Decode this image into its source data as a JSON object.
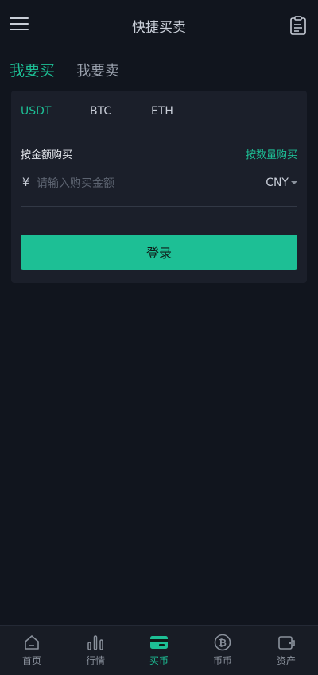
{
  "header": {
    "title": "快捷买卖",
    "menu_icon": "hamburger-icon",
    "orders_icon": "order-list-icon"
  },
  "trade_tabs": [
    {
      "label": "我要买",
      "active": true
    },
    {
      "label": "我要卖",
      "active": false
    }
  ],
  "coin_tabs": [
    {
      "label": "USDT",
      "active": true
    },
    {
      "label": "BTC",
      "active": false
    },
    {
      "label": "ETH",
      "active": false
    }
  ],
  "form": {
    "mode_label": "按金额购买",
    "mode_switch": "按数量购买",
    "currency_symbol": "¥",
    "amount_placeholder": "请输入购买金额",
    "amount_value": "",
    "fiat_currency": "CNY",
    "submit_label": "登录"
  },
  "bottom_nav": [
    {
      "label": "首页",
      "icon": "home-icon",
      "active": false
    },
    {
      "label": "行情",
      "icon": "bar-chart-icon",
      "active": false
    },
    {
      "label": "买币",
      "icon": "wallet-card-icon",
      "active": true
    },
    {
      "label": "币币",
      "icon": "bitcoin-icon",
      "active": false
    },
    {
      "label": "资产",
      "icon": "asset-wallet-icon",
      "active": false
    }
  ],
  "colors": {
    "accent": "#1dbf95",
    "background": "#11151e",
    "card": "#1b1f2a",
    "text": "#c9ced8",
    "muted": "#8a919c"
  }
}
